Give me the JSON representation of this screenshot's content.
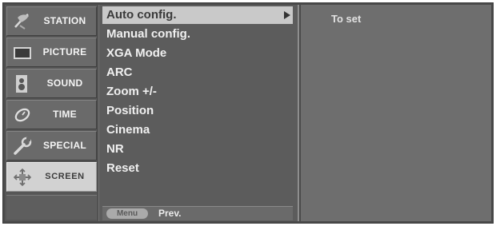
{
  "categories": [
    {
      "label": "STATION",
      "icon": "antenna-icon",
      "selected": false
    },
    {
      "label": "PICTURE",
      "icon": "tv-screen-icon",
      "selected": false
    },
    {
      "label": "SOUND",
      "icon": "speaker-icon",
      "selected": false
    },
    {
      "label": "TIME",
      "icon": "clock-icon",
      "selected": false
    },
    {
      "label": "SPECIAL",
      "icon": "wrench-icon",
      "selected": false
    },
    {
      "label": "SCREEN",
      "icon": "screen-adjust-icon",
      "selected": true
    }
  ],
  "options": [
    {
      "label": "Auto config.",
      "active": true
    },
    {
      "label": "Manual config.",
      "active": false
    },
    {
      "label": "XGA Mode",
      "active": false
    },
    {
      "label": "ARC",
      "active": false
    },
    {
      "label": "Zoom +/-",
      "active": false
    },
    {
      "label": "Position",
      "active": false
    },
    {
      "label": "Cinema",
      "active": false
    },
    {
      "label": "NR",
      "active": false
    },
    {
      "label": "Reset",
      "active": false
    }
  ],
  "nav": {
    "menu_label": "Menu",
    "prev_label": "Prev."
  },
  "info": {
    "text": "To set"
  }
}
